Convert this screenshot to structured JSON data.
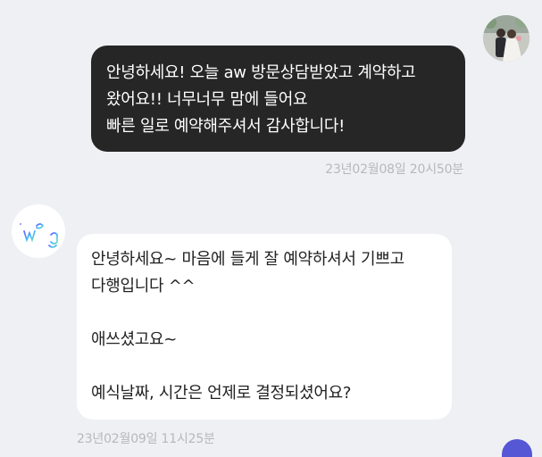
{
  "conversation": {
    "outgoing": {
      "lines": [
        "안녕하세요! 오늘 aw 방문상담받았고 계약하고",
        "왔어요!! 너무너무 맘에 들어요",
        "빠른 일로 예약해주셔서 감사합니다!"
      ],
      "timestamp": "23년02월08일 20시50분"
    },
    "incoming": {
      "lines": [
        "안녕하세요~ 마음에 들게 잘 예약하셔서 기쁘고",
        "다행입니다 ^^",
        "",
        "애쓰셨고요~",
        "",
        "예식날짜, 시간은 언제로 결정되셨어요?"
      ],
      "timestamp": "23년02월09일 11시25분"
    }
  },
  "colors": {
    "background": "#eef0f4",
    "outgoing_bubble": "#262626",
    "incoming_bubble": "#ffffff",
    "timestamp": "#b5b8bd",
    "logo_gradient": [
      "#6a5cff",
      "#3fb6ff",
      "#7be0b0"
    ]
  },
  "icons": {
    "user_avatar": "couple-photo-avatar",
    "shop_avatar": "jwedding-logo-avatar"
  }
}
